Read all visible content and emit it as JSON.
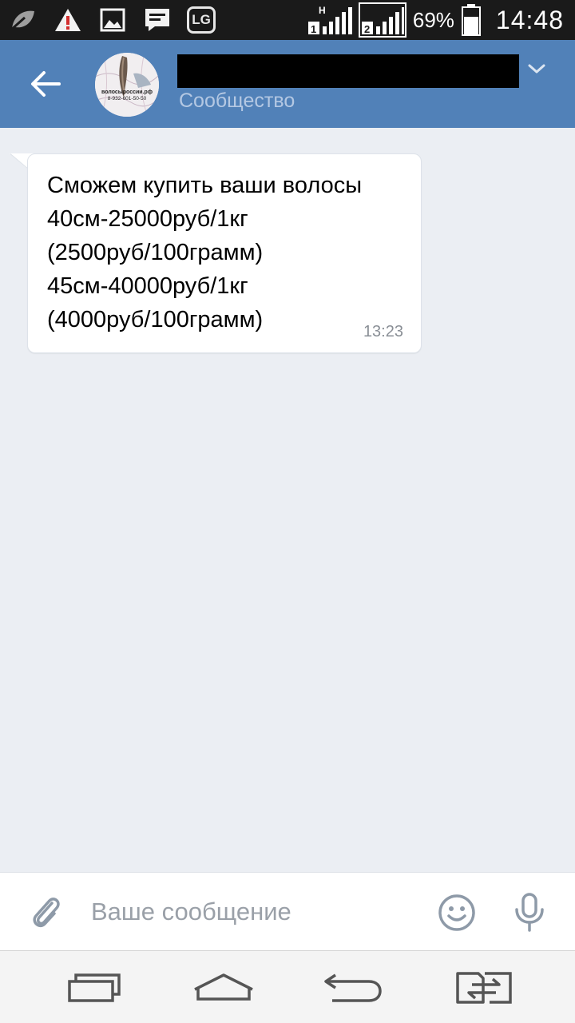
{
  "status_bar": {
    "icons": [
      "leaf-icon",
      "warning-icon",
      "gallery-icon",
      "message-icon",
      "lg-icon",
      "sim1-signal-icon",
      "sim2-signal-icon",
      "battery-icon"
    ],
    "lg_label": "LG",
    "network_badge": "H",
    "sim1_label": "1",
    "sim2_label": "2",
    "battery_percent": "69%",
    "battery_level": 0.69,
    "time": "14:48"
  },
  "header": {
    "subtitle": "Сообщество",
    "avatar_text_line1": "волосыроссии.рф",
    "avatar_text_line2": "8-932-601-50-50",
    "colors": {
      "bar": "#5181b8",
      "subtitle": "#b4c8e3"
    }
  },
  "conversation": {
    "messages": [
      {
        "lines": [
          "Сможем купить ваши волосы",
          "40см-25000руб/1кг",
          "(2500руб/100грамм)",
          "45см-40000руб/1кг",
          "(4000руб/100грамм)"
        ],
        "time": "13:23"
      }
    ]
  },
  "composer": {
    "placeholder": "Ваше сообщение",
    "value": ""
  },
  "navbar": {
    "buttons": [
      "recents-icon",
      "home-icon",
      "back-nav-icon",
      "dual-window-icon"
    ]
  }
}
